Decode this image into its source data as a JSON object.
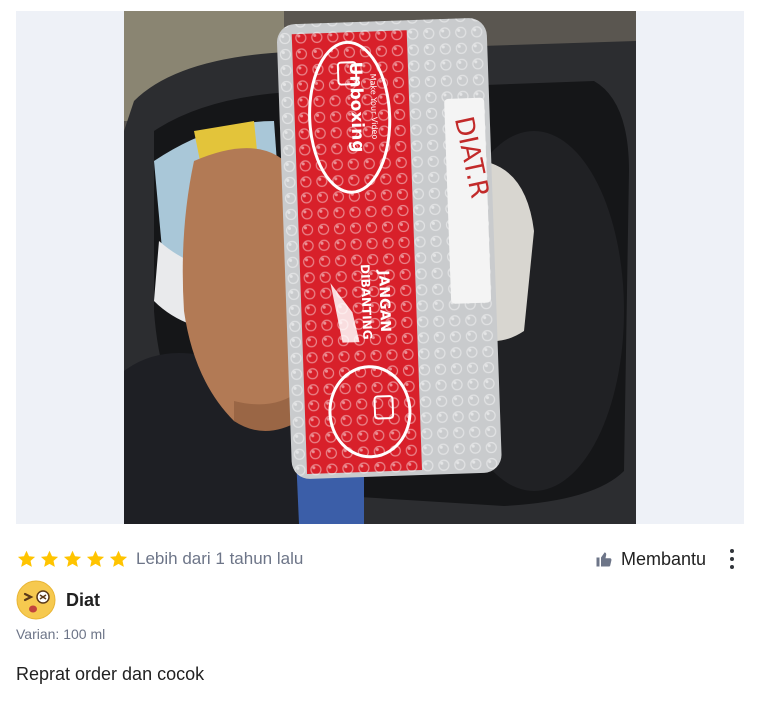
{
  "review": {
    "rating": 5,
    "rating_max": 5,
    "time_ago": "Lebih dari 1 tahun lalu",
    "helpful_label": "Membantu",
    "more_icon": "more-vertical-icon",
    "reviewer_name": "Diat",
    "variant": "Varian: 100 ml",
    "text": "Reprat order dan cocok"
  },
  "photo": {
    "tape_lines": [
      "Make Your Video",
      "Unboxing",
      "JANGAN",
      "DIBANTING"
    ],
    "handwriting": "DIAT.R"
  },
  "colors": {
    "star": "#ffc400",
    "tape_red": "#d8202a",
    "photo_bg": "#eef1f7",
    "muted_text": "#6d7588"
  }
}
